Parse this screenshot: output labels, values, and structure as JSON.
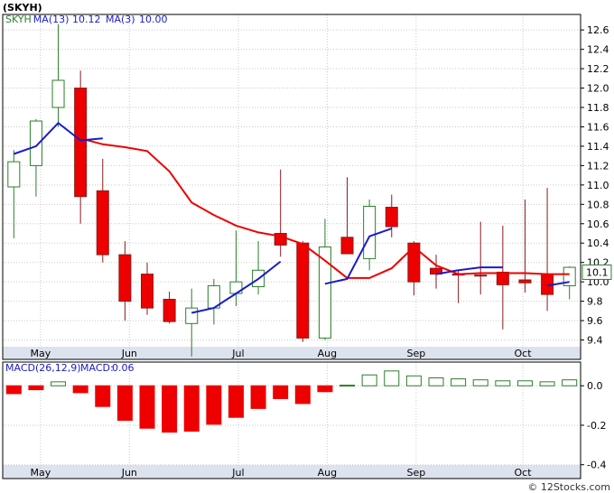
{
  "page_title": "(SKYH)",
  "copyright": "© 12Stocks.com",
  "chart_data": [
    {
      "type": "candlestick",
      "legend": [
        {
          "text": "SKYH",
          "color": "#2a7f2a"
        },
        {
          "text": "MA(13)",
          "color": "#1a1acc"
        },
        {
          "text": "10.12",
          "color": "#1a1acc"
        },
        {
          "text": "MA(3)",
          "color": "#1a1acc"
        },
        {
          "text": "10.00",
          "color": "#1a1acc"
        }
      ],
      "ylim": [
        9.2,
        12.76
      ],
      "y_ticks": [
        "12.6",
        "12.4",
        "12.2",
        "12.0",
        "11.8",
        "11.6",
        "11.4",
        "11.2",
        "11.0",
        "10.8",
        "10.6",
        "10.4",
        "10.2",
        "10.0",
        "9.8",
        "9.6",
        "9.4"
      ],
      "x_labels": [
        {
          "text": "May",
          "i": 1.2
        },
        {
          "text": "Jun",
          "i": 5.2
        },
        {
          "text": "Jul",
          "i": 10.1
        },
        {
          "text": "Aug",
          "i": 14.1
        },
        {
          "text": "Sep",
          "i": 18.1
        },
        {
          "text": "Oct",
          "i": 22.9
        }
      ],
      "last_price": "10.1",
      "candles": [
        {
          "o": 10.98,
          "h": 11.36,
          "l": 10.45,
          "c": 11.24
        },
        {
          "o": 11.2,
          "h": 11.68,
          "l": 10.88,
          "c": 11.66
        },
        {
          "o": 11.8,
          "h": 12.66,
          "l": 11.6,
          "c": 12.08
        },
        {
          "o": 12.0,
          "h": 12.18,
          "l": 10.6,
          "c": 10.88
        },
        {
          "o": 10.94,
          "h": 11.27,
          "l": 10.2,
          "c": 10.28
        },
        {
          "o": 10.28,
          "h": 10.42,
          "l": 9.6,
          "c": 9.8
        },
        {
          "o": 10.08,
          "h": 10.2,
          "l": 9.66,
          "c": 9.73
        },
        {
          "o": 9.82,
          "h": 9.9,
          "l": 9.57,
          "c": 9.59
        },
        {
          "o": 9.57,
          "h": 9.93,
          "l": 9.23,
          "c": 9.73
        },
        {
          "o": 9.73,
          "h": 10.03,
          "l": 9.56,
          "c": 9.96
        },
        {
          "o": 9.88,
          "h": 10.53,
          "l": 9.75,
          "c": 10.0
        },
        {
          "o": 9.95,
          "h": 10.42,
          "l": 9.87,
          "c": 10.12
        },
        {
          "o": 10.5,
          "h": 11.16,
          "l": 10.26,
          "c": 10.38
        },
        {
          "o": 10.4,
          "h": 10.42,
          "l": 9.38,
          "c": 9.42
        },
        {
          "o": 9.42,
          "h": 10.65,
          "l": 9.4,
          "c": 10.36
        },
        {
          "o": 10.46,
          "h": 11.08,
          "l": 10.32,
          "c": 10.29
        },
        {
          "o": 10.24,
          "h": 10.85,
          "l": 10.12,
          "c": 10.78
        },
        {
          "o": 10.77,
          "h": 10.9,
          "l": 10.46,
          "c": 10.57
        },
        {
          "o": 10.4,
          "h": 10.42,
          "l": 9.86,
          "c": 10.0
        },
        {
          "o": 10.14,
          "h": 10.28,
          "l": 9.93,
          "c": 10.08
        },
        {
          "o": 10.08,
          "h": 10.12,
          "l": 9.78,
          "c": 10.07
        },
        {
          "o": 10.07,
          "h": 10.62,
          "l": 9.87,
          "c": 10.06
        },
        {
          "o": 10.1,
          "h": 10.58,
          "l": 9.51,
          "c": 9.97
        },
        {
          "o": 10.02,
          "h": 10.85,
          "l": 9.89,
          "c": 9.99
        },
        {
          "o": 10.08,
          "h": 10.97,
          "l": 9.7,
          "c": 9.87
        },
        {
          "o": 9.96,
          "h": 10.16,
          "l": 9.82,
          "c": 10.15
        }
      ],
      "ma13": [
        null,
        null,
        null,
        11.48,
        11.42,
        11.39,
        11.35,
        11.14,
        10.82,
        10.69,
        10.58,
        10.51,
        10.47,
        10.39,
        10.22,
        10.04,
        10.04,
        10.14,
        10.36,
        10.17,
        10.08,
        10.09,
        10.09,
        10.09,
        10.08,
        10.08
      ],
      "ma3": [
        11.32,
        11.4,
        11.64,
        11.46,
        11.48,
        null,
        null,
        null,
        9.68,
        9.73,
        9.88,
        10.03,
        10.21,
        null,
        9.98,
        10.03,
        10.47,
        10.55,
        null,
        10.08,
        10.12,
        10.15,
        10.15,
        null,
        9.96,
        10.0
      ],
      "colors": {
        "up": "#2a7f2a",
        "down": "#ee0000",
        "ma13": "#ee0000",
        "ma3": "#1a1acc"
      }
    },
    {
      "type": "bar",
      "title": "MACD(26,12,9)",
      "legend": [
        {
          "text": "MACD(26,12,9)",
          "color": "#1a1acc"
        },
        {
          "text": "MACD:",
          "color": "#1a1acc"
        },
        {
          "text": "0.06",
          "color": "#1a1acc"
        }
      ],
      "ylim": [
        -0.47,
        0.12
      ],
      "y_ticks": [
        "0.0",
        "-0.2",
        "-0.4"
      ],
      "x_labels": [
        {
          "text": "May",
          "i": 1.2
        },
        {
          "text": "Jun",
          "i": 5.2
        },
        {
          "text": "Jul",
          "i": 10.1
        },
        {
          "text": "Aug",
          "i": 14.1
        },
        {
          "text": "Sep",
          "i": 18.1
        },
        {
          "text": "Oct",
          "i": 22.9
        }
      ],
      "values": [
        -0.04,
        -0.02,
        0.02,
        -0.035,
        -0.105,
        -0.175,
        -0.215,
        -0.235,
        -0.23,
        -0.195,
        -0.16,
        -0.115,
        -0.065,
        -0.09,
        -0.03,
        0.003,
        0.055,
        0.075,
        0.05,
        0.04,
        0.035,
        0.03,
        0.025,
        0.025,
        0.02,
        0.03
      ],
      "colors": {
        "up": "#2a7f2a",
        "down": "#ee0000"
      }
    }
  ]
}
